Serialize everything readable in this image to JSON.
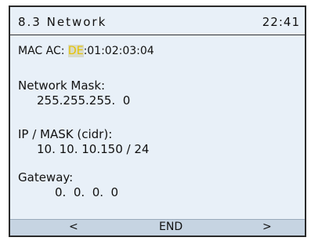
{
  "header": {
    "title": "8.3 Network",
    "clock": "22:41"
  },
  "mac": {
    "label": "MAC AC: ",
    "prefix": "DE",
    "rest": ":01:02:03:04"
  },
  "network_mask": {
    "label": "Network Mask:",
    "value": "255.255.255.  0"
  },
  "ip_mask": {
    "label": "IP / MASK (cidr):",
    "value": "10. 10. 10.150 / 24"
  },
  "gateway": {
    "label": "Gateway:",
    "value": "0.  0.  0.  0"
  },
  "footer": {
    "prev": "<",
    "end": "END",
    "next": ">"
  },
  "colors": {
    "highlight_text": "#e6c200",
    "screen_bg": "#e8f0f8",
    "bar_bg": "#c6d4e2"
  }
}
